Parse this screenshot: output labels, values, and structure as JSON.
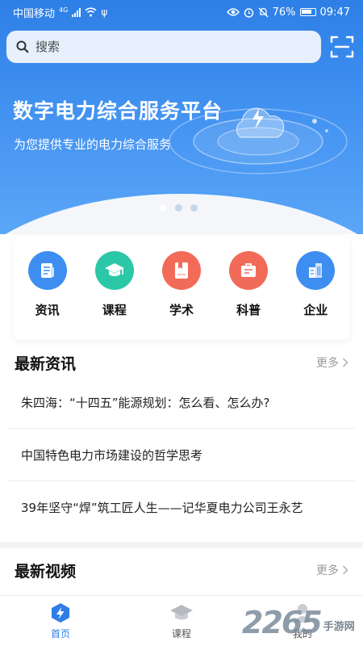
{
  "status_bar": {
    "carrier": "中国移动",
    "network": "4G",
    "battery": "76%",
    "time": "09:47"
  },
  "search": {
    "placeholder": "搜索"
  },
  "banner": {
    "title": "数字电力综合服务平台",
    "subtitle": "为您提供专业的电力综合服务",
    "slides": 3,
    "active_slide": 0
  },
  "quick_menu": [
    {
      "label": "资讯",
      "icon": "document-icon",
      "color": "#3d8ef0"
    },
    {
      "label": "课程",
      "icon": "graduation-cap-icon",
      "color": "#2cc7a6"
    },
    {
      "label": "学术",
      "icon": "book-icon",
      "color": "#f26b58"
    },
    {
      "label": "科普",
      "icon": "briefcase-icon",
      "color": "#f26b58"
    },
    {
      "label": "企业",
      "icon": "building-icon",
      "color": "#3d8ef0"
    }
  ],
  "news_section": {
    "title": "最新资讯",
    "more": "更多",
    "items": [
      "朱四海：“十四五”能源规划：怎么看、怎么办?",
      "中国特色电力市场建设的哲学思考",
      "39年坚守“焊”筑工匠人生——记华夏电力公司王永艺"
    ]
  },
  "video_section": {
    "title": "最新视频",
    "more": "更多"
  },
  "bottom_nav": [
    {
      "label": "首页",
      "icon": "home-bolt-icon",
      "active": true
    },
    {
      "label": "课程",
      "icon": "graduation-cap-icon",
      "active": false
    },
    {
      "label": "我的",
      "icon": "user-icon",
      "active": false
    }
  ],
  "watermark": {
    "number": "2265",
    "text": "手游网"
  },
  "colors": {
    "primary": "#2f7de6",
    "banner_top": "#2e7fe6",
    "banner_bottom": "#5aa6f7"
  }
}
